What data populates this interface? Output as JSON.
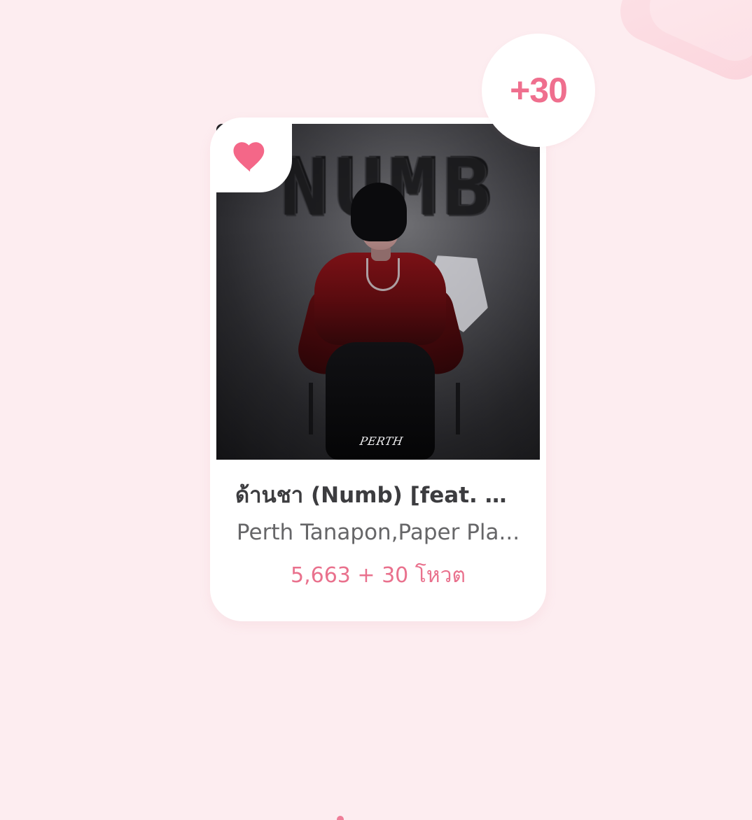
{
  "theme": {
    "background": "#fdedf0",
    "card": "#ffffff",
    "accent": "#ef6f8e",
    "text_primary": "#3c3c3f",
    "text_secondary": "#666668"
  },
  "song_card": {
    "vote_bonus": "+30",
    "cover_title_art": "NUMB",
    "cover_logo": "PERTH",
    "title": "ด้านชา (Numb) [feat. Pa...",
    "artist": "Perth Tanapon,Paper Pla...",
    "vote_summary": "5,663 + 30 โหวต",
    "icons": {
      "favorite": "heart-icon"
    }
  }
}
